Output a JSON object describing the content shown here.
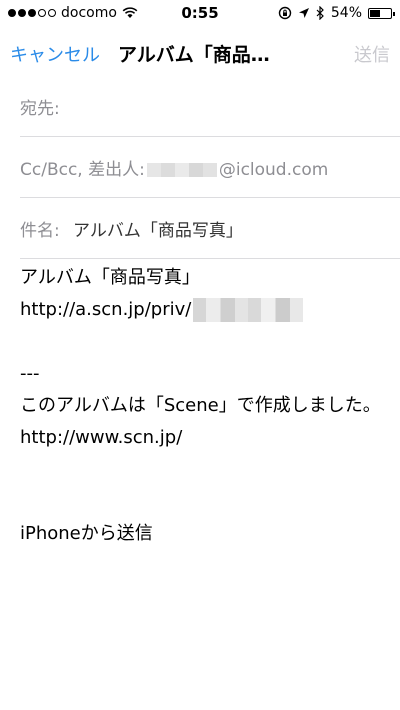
{
  "status_bar": {
    "carrier": "docomo",
    "time": "0:55",
    "battery_percent_text": "54%",
    "battery_level": 0.54,
    "signal_bars_filled": 3,
    "signal_bars_total": 5
  },
  "nav": {
    "cancel_label": "キャンセル",
    "title": "アルバム「商品…",
    "send_label": "送信"
  },
  "fields": {
    "to_label": "宛先:",
    "cc_label": "Cc/Bcc, 差出人:",
    "cc_domain": "@icloud.com",
    "subject_label": "件名:",
    "subject_value": "アルバム「商品写真」"
  },
  "body": {
    "line1": "アルバム「商品写真」",
    "url_prefix": "http://a.scn.jp/priv/",
    "separator": "---",
    "made_with": "このアルバムは「Scene」で作成しました。",
    "site_url": "http://www.scn.jp/",
    "signature": "iPhoneから送信"
  },
  "colors": {
    "accent": "#2a8be8",
    "disabled": "#c9c9ce",
    "label_gray": "#8e8e93"
  }
}
